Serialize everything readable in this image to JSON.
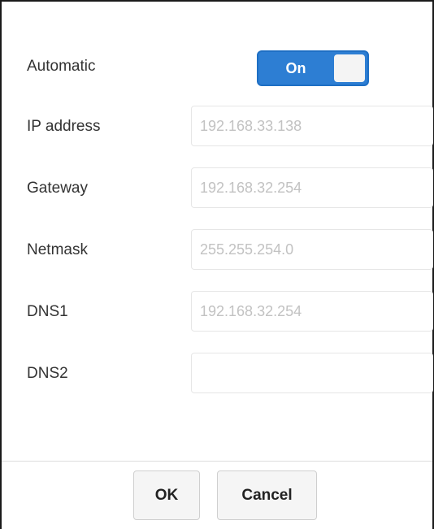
{
  "automatic": {
    "label": "Automatic",
    "toggle_text": "On"
  },
  "fields": {
    "ip_address": {
      "label": "IP address",
      "placeholder": "192.168.33.138",
      "value": ""
    },
    "gateway": {
      "label": "Gateway",
      "placeholder": "192.168.32.254",
      "value": ""
    },
    "netmask": {
      "label": "Netmask",
      "placeholder": "255.255.254.0",
      "value": ""
    },
    "dns1": {
      "label": "DNS1",
      "placeholder": "192.168.32.254",
      "value": ""
    },
    "dns2": {
      "label": "DNS2",
      "placeholder": "",
      "value": ""
    }
  },
  "buttons": {
    "ok": "OK",
    "cancel": "Cancel"
  },
  "colors": {
    "toggle_on": "#2d7ed3",
    "placeholder": "#c2c2c2"
  }
}
